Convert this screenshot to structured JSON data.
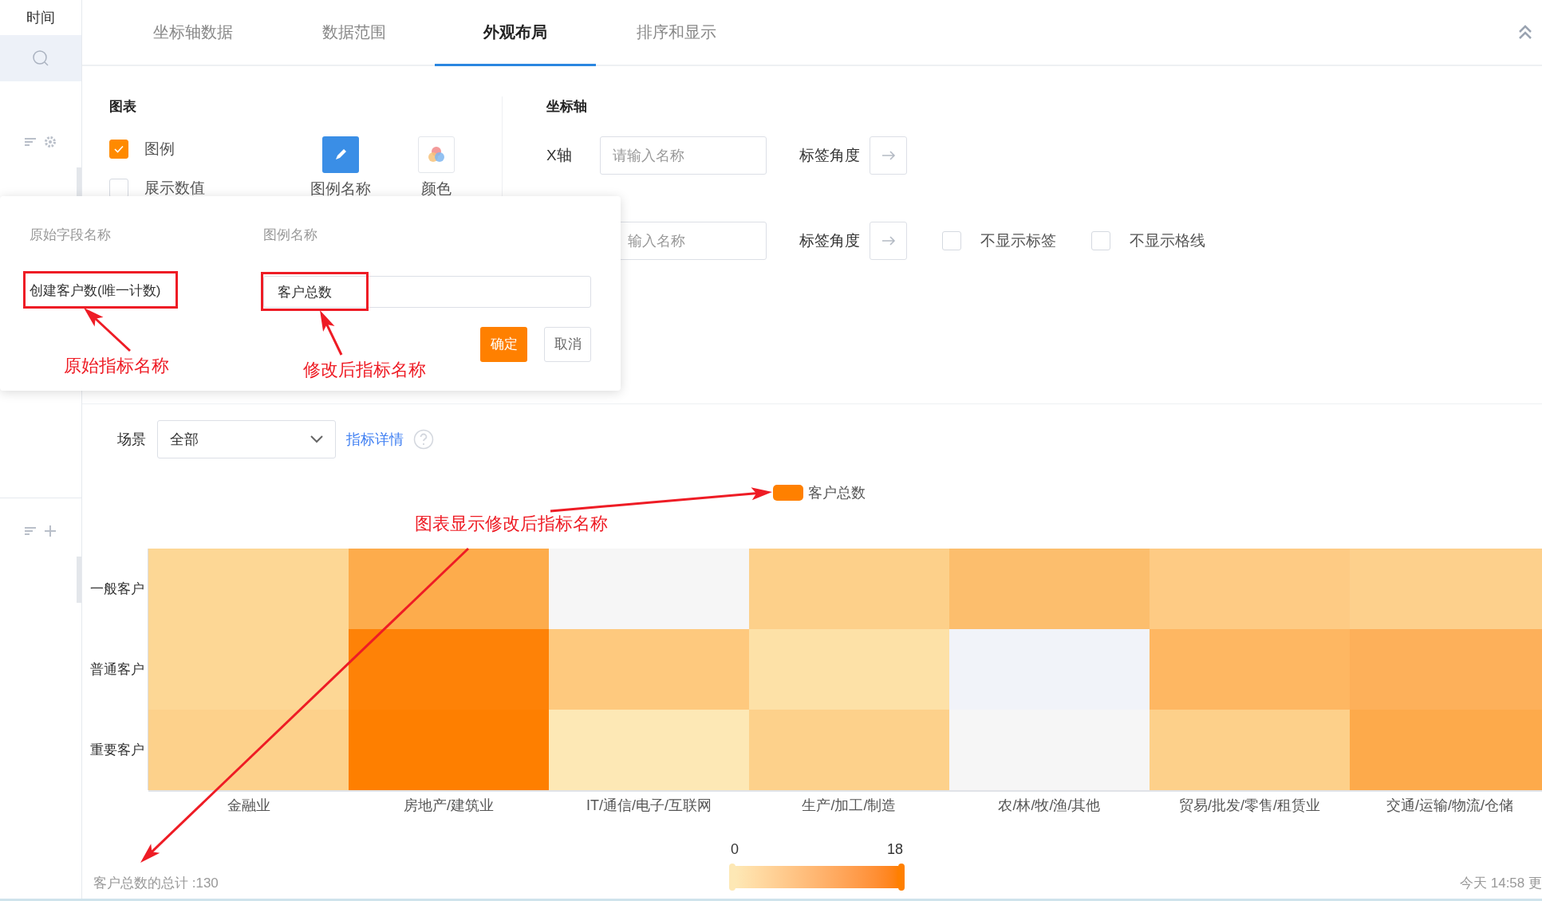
{
  "sidebar": {
    "title": "时间"
  },
  "tabs": [
    {
      "label": "坐标轴数据",
      "selected": false
    },
    {
      "label": "数据范围",
      "selected": false
    },
    {
      "label": "外观布局",
      "selected": true
    },
    {
      "label": "排序和显示",
      "selected": false
    }
  ],
  "chart_settings": {
    "heading": "图表",
    "options": [
      {
        "label": "图例",
        "checked": true
      },
      {
        "label": "展示数值",
        "checked": false
      }
    ],
    "tools": [
      {
        "kind": "pencil",
        "label": "图例名称"
      },
      {
        "kind": "palette",
        "label": "颜色"
      }
    ]
  },
  "axis_settings": {
    "heading": "坐标轴",
    "rows": [
      {
        "label": "X轴",
        "placeholder": "请输入名称",
        "angle_label": "标签角度",
        "options": []
      },
      {
        "label": "",
        "placeholder": "输入名称",
        "angle_label": "标签角度",
        "options": [
          {
            "label": "不显示标签",
            "checked": false
          },
          {
            "label": "不显示格线",
            "checked": false
          }
        ]
      }
    ]
  },
  "legend_popup": {
    "column_1": "原始字段名称",
    "column_2": "图例名称",
    "field_name": "创建客户数(唯一计数)",
    "legend_value": "客户总数",
    "confirm": "确定",
    "cancel": "取消",
    "note_original": "原始指标名称",
    "note_modified": "修改后指标名称"
  },
  "toolbar": {
    "label": "场景",
    "select_value": "全部",
    "link": "指标详情"
  },
  "chart_note": "图表显示修改后指标名称",
  "heatmap": {
    "legend": "客户总数",
    "rows": [
      {
        "label": "一般客户",
        "cells": [
          {
            "color": "#fdd795"
          },
          {
            "color": "#fdac4c"
          },
          {
            "color": "#f6f6f6"
          },
          {
            "color": "#fdd08a"
          },
          {
            "color": "#fcbe6d"
          },
          {
            "color": "#fecb84"
          },
          {
            "color": "#fdd08c"
          }
        ]
      },
      {
        "label": "普通客户",
        "cells": [
          {
            "color": "#fdd795"
          },
          {
            "color": "#fe8207"
          },
          {
            "color": "#fec97e"
          },
          {
            "color": "#fde1a7"
          },
          {
            "color": "#f1f3f9"
          },
          {
            "color": "#feb762"
          },
          {
            "color": "#fdb05a"
          }
        ]
      },
      {
        "label": "重要客户",
        "cells": [
          {
            "color": "#fdd18b"
          },
          {
            "color": "#fe7f00"
          },
          {
            "color": "#fde8b5"
          },
          {
            "color": "#fdd18b"
          },
          {
            "color": "#f6f6f6"
          },
          {
            "color": "#fdd08a"
          },
          {
            "color": "#fdaa4b"
          }
        ]
      }
    ],
    "columns": [
      "金融业",
      "房地产/建筑业",
      "IT/通信/电子/互联网",
      "生产/加工/制造",
      "农/林/牧/渔/其他",
      "贸易/批发/零售/租赁业",
      "交通/运输/物流/仓储"
    ],
    "scale_min": "0",
    "scale_max": "18"
  },
  "footer": {
    "total": "客户总数的总计 :130",
    "updated": "今天 14:58 更"
  }
}
